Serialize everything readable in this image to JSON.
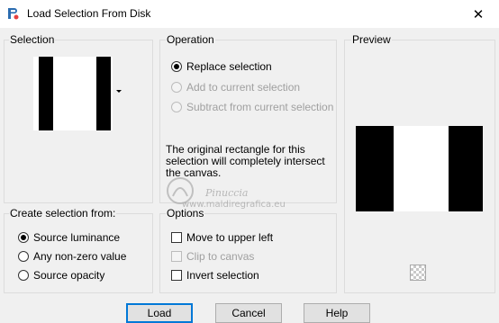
{
  "window": {
    "title": "Load Selection From Disk",
    "close_glyph": "✕"
  },
  "selection_group": {
    "label": "Selection"
  },
  "operation_group": {
    "label": "Operation",
    "options": [
      {
        "label": "Replace selection",
        "checked": true,
        "enabled": true
      },
      {
        "label": "Add to current selection",
        "checked": false,
        "enabled": false
      },
      {
        "label": "Subtract from current selection",
        "checked": false,
        "enabled": false
      }
    ],
    "info_text": "The original rectangle for this selection will completely intersect the canvas."
  },
  "preview_group": {
    "label": "Preview",
    "checker_icon": "transparency-checker-icon"
  },
  "create_group": {
    "label": "Create selection from:",
    "options": [
      {
        "label": "Source luminance",
        "checked": true
      },
      {
        "label": "Any non-zero value",
        "checked": false
      },
      {
        "label": "Source opacity",
        "checked": false
      }
    ]
  },
  "options_group": {
    "label": "Options",
    "checks": [
      {
        "label": "Move to upper left",
        "checked": false,
        "enabled": true
      },
      {
        "label": "Clip to canvas",
        "checked": false,
        "enabled": false
      },
      {
        "label": "Invert selection",
        "checked": false,
        "enabled": true
      }
    ]
  },
  "buttons": {
    "load": "Load",
    "cancel": "Cancel",
    "help": "Help"
  },
  "watermark": {
    "line1": "Pinuccia",
    "line2": "www.maldiregrafica.eu"
  },
  "colors": {
    "accent": "#0078d7",
    "background": "#f0f0f0"
  }
}
